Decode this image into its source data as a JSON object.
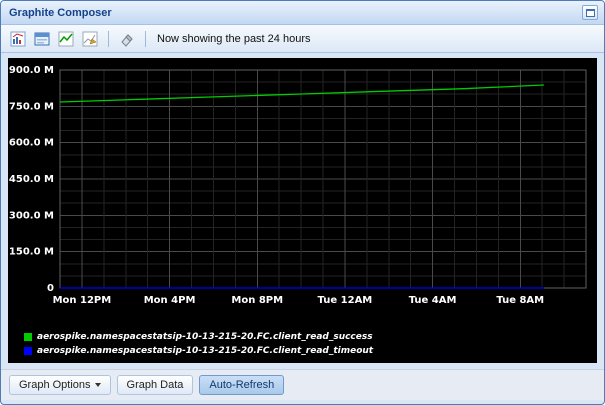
{
  "window": {
    "title": "Graphite Composer",
    "collapse_icon": "collapse-icon"
  },
  "toolbar": {
    "status_text": "Now showing the past 24 hours",
    "icons": [
      "update-graph-icon",
      "graph-window-icon",
      "line-mode-icon",
      "edit-graph-icon",
      "eraser-icon"
    ]
  },
  "chart_data": {
    "type": "line",
    "background": "#000000",
    "grid": true,
    "legend_position": "bottom-left",
    "x_span_hours": 24,
    "x_ticks": [
      "Mon 12PM",
      "Mon 4PM",
      "Mon 8PM",
      "Tue 12AM",
      "Tue 4AM",
      "Tue 8AM"
    ],
    "y_ticks": [
      "900.0 M",
      "750.0 M",
      "600.0 M",
      "450.0 M",
      "300.0 M",
      "150.0 M",
      "0"
    ],
    "ylim": [
      0,
      900
    ],
    "value_unit": "millions",
    "series": [
      {
        "name": "aerospike.namespacestatsip-10-13-215-20.FC.client_read_success",
        "color": "#00cc00",
        "values": [
          768,
          779,
          790,
          801,
          812,
          823,
          838
        ]
      },
      {
        "name": "aerospike.namespacestatsip-10-13-215-20.FC.client_read_timeout",
        "color": "#0000ff",
        "values": [
          0,
          0,
          0,
          0,
          0,
          0,
          0
        ]
      }
    ]
  },
  "footer": {
    "graph_options_label": "Graph Options",
    "graph_data_label": "Graph Data",
    "auto_refresh_label": "Auto-Refresh"
  }
}
